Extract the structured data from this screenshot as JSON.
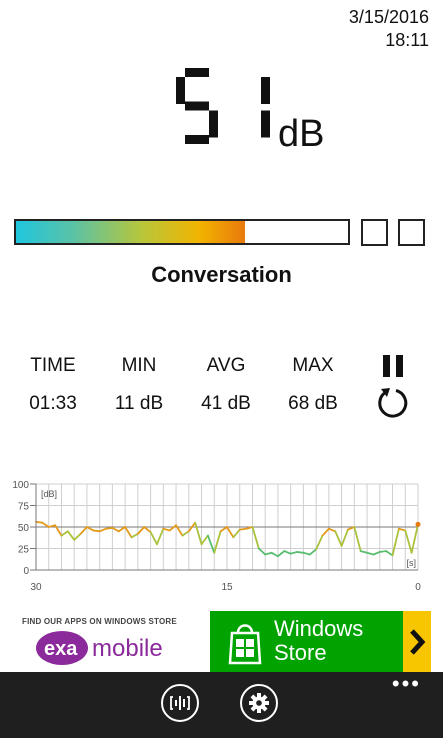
{
  "status": {
    "date": "3/15/2016",
    "time": "18:11"
  },
  "reading": {
    "value": "51",
    "unit": "dB"
  },
  "level_bar": {
    "fill_fraction": 0.69,
    "gradient_colors": [
      "#1fc6de",
      "#b7c63a",
      "#f2b400",
      "#e87a0c"
    ]
  },
  "category": "Conversation",
  "stats": {
    "time_label": "TIME",
    "time_value": "01:33",
    "min_label": "MIN",
    "min_value": "11 dB",
    "avg_label": "AVG",
    "avg_value": "41 dB",
    "max_label": "MAX",
    "max_value": "68 dB"
  },
  "controls": {
    "pause_icon": "pause-icon",
    "reset_icon": "reset-icon"
  },
  "chart_data": {
    "type": "line",
    "unit_label": "[dB]",
    "time_unit_label": "[s]",
    "y_ticks": [
      "100",
      "75",
      "50",
      "25",
      "0"
    ],
    "x_ticks": [
      "30",
      "15",
      "0"
    ],
    "ylim": [
      0,
      100
    ],
    "xlim": [
      30,
      0
    ],
    "grid": true,
    "x": [
      30,
      29.5,
      29,
      28.5,
      28,
      27.5,
      27,
      26.5,
      26,
      25.5,
      25,
      24.5,
      24,
      23.5,
      23,
      22.5,
      22,
      21.5,
      21,
      20.5,
      20,
      19.5,
      19,
      18.5,
      18,
      17.5,
      17,
      16.5,
      16,
      15.5,
      15,
      14.5,
      14,
      13.5,
      13,
      12.5,
      12,
      11.5,
      11,
      10.5,
      10,
      9.5,
      9,
      8.5,
      8,
      7.5,
      7,
      6.5,
      6,
      5.5,
      5,
      4.5,
      4,
      3.5,
      3,
      2.5,
      2,
      1.5,
      1,
      0.5,
      0
    ],
    "y": [
      56,
      55,
      50,
      52,
      40,
      45,
      35,
      42,
      50,
      46,
      45,
      48,
      49,
      45,
      50,
      38,
      42,
      50,
      44,
      30,
      48,
      46,
      52,
      40,
      45,
      55,
      30,
      40,
      20,
      45,
      50,
      38,
      47,
      48,
      50,
      25,
      18,
      20,
      16,
      22,
      19,
      21,
      20,
      18,
      24,
      40,
      48,
      45,
      28,
      47,
      50,
      22,
      20,
      18,
      21,
      22,
      17,
      48,
      46,
      20,
      53
    ]
  },
  "ad": {
    "find_text": "FIND OUR APPS ON WINDOWS STORE",
    "logo_exa": "exa",
    "logo_mobile": "mobile",
    "store_line1": "Windows",
    "store_line2": "Store",
    "colors": {
      "store_bg": "#00a300",
      "arrow_bg": "#f7c600",
      "exa_purple": "#8b2a9b"
    }
  },
  "appbar": {
    "left_icon": "equalizer-icon",
    "right_icon": "settings-gear-icon",
    "more": "•••"
  }
}
